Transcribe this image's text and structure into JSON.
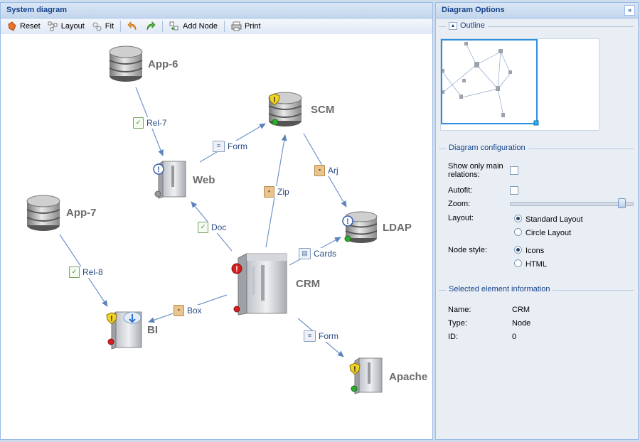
{
  "left_panel": {
    "title": "System diagram",
    "toolbar": {
      "reset": "Reset",
      "layout": "Layout",
      "fit": "Fit",
      "add_node": "Add Node",
      "print": "Print"
    }
  },
  "diagram": {
    "nodes": {
      "app6": "App-6",
      "scm": "SCM",
      "web": "Web",
      "app7": "App-7",
      "ldap": "LDAP",
      "crm": "CRM",
      "bi": "BI",
      "apache": "Apache"
    },
    "edges": {
      "rel7": "Rel-7",
      "form_scm_web": "Form",
      "zip": "Zip",
      "arj": "Arj",
      "doc": "Doc",
      "cards": "Cards",
      "rel8": "Rel-8",
      "box": "Box",
      "form_crm_apache": "Form"
    }
  },
  "right_panel": {
    "title": "Diagram Options",
    "outline": {
      "title": "Outline"
    },
    "config": {
      "title": "Diagram configuration",
      "show_main_relations_label": "Show only main relations:",
      "show_main_relations_checked": false,
      "autofit_label": "Autofit:",
      "autofit_checked": false,
      "zoom_label": "Zoom:",
      "zoom_value": 0.93,
      "layout_label": "Layout:",
      "layout_options": [
        "Standard Layout",
        "Circle Layout"
      ],
      "layout_selected": "Standard Layout",
      "node_style_label": "Node style:",
      "node_style_options": [
        "Icons",
        "HTML"
      ],
      "node_style_selected": "Icons"
    },
    "selected_info": {
      "title": "Selected element information",
      "name_label": "Name:",
      "name_value": "CRM",
      "type_label": "Type:",
      "type_value": "Node",
      "id_label": "ID:",
      "id_value": "0"
    }
  },
  "colors": {
    "header_text": "#15428b",
    "edge": "#6b8fc4",
    "edge_label": "#2b4a80",
    "node_label": "#6b6b6b"
  }
}
